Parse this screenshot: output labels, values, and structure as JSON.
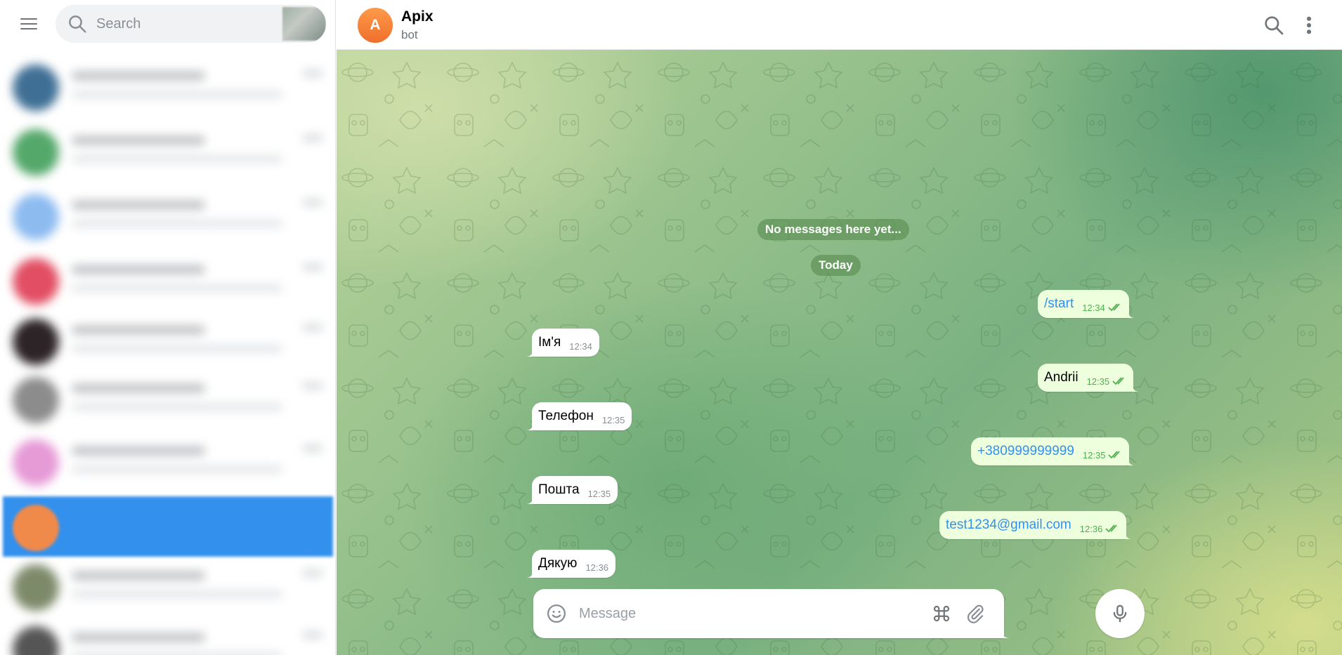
{
  "sidebar": {
    "search": {
      "placeholder": "Search"
    },
    "chats": [
      {
        "avatar_color": "#3f6f95"
      },
      {
        "avatar_color": "#54a86a"
      },
      {
        "avatar_color": "#8dbbf0"
      },
      {
        "avatar_color": "#e24e63"
      },
      {
        "avatar_color": "#2c2426"
      },
      {
        "avatar_color": "#8c8c8c"
      },
      {
        "avatar_color": "#e69ad6"
      },
      {
        "avatar_color": "#f08a4b",
        "active": true
      },
      {
        "avatar_color": "#7d8a6a"
      },
      {
        "avatar_color": "#555555"
      }
    ]
  },
  "header": {
    "avatar_letter": "A",
    "title": "Apix",
    "subtitle": "bot"
  },
  "service": {
    "empty": "No messages here yet...",
    "date": "Today"
  },
  "messages": [
    {
      "dir": "out",
      "text": "/start",
      "time": "12:34",
      "link": true
    },
    {
      "dir": "in",
      "text": "Ім'я",
      "time": "12:34"
    },
    {
      "dir": "out",
      "text": "Andrii",
      "time": "12:35"
    },
    {
      "dir": "in",
      "text": "Телефон",
      "time": "12:35"
    },
    {
      "dir": "out",
      "text": "+380999999999",
      "time": "12:35",
      "link": true
    },
    {
      "dir": "in",
      "text": "Пошта",
      "time": "12:35"
    },
    {
      "dir": "out",
      "text": "test1234@gmail.com",
      "time": "12:36",
      "link": true
    },
    {
      "dir": "in",
      "text": "Дякую",
      "time": "12:36"
    }
  ],
  "composer": {
    "placeholder": "Message"
  },
  "colors": {
    "accent": "#3390ec",
    "outgoing_bubble": "#eeffde",
    "read_ticks": "#4fae4e"
  }
}
